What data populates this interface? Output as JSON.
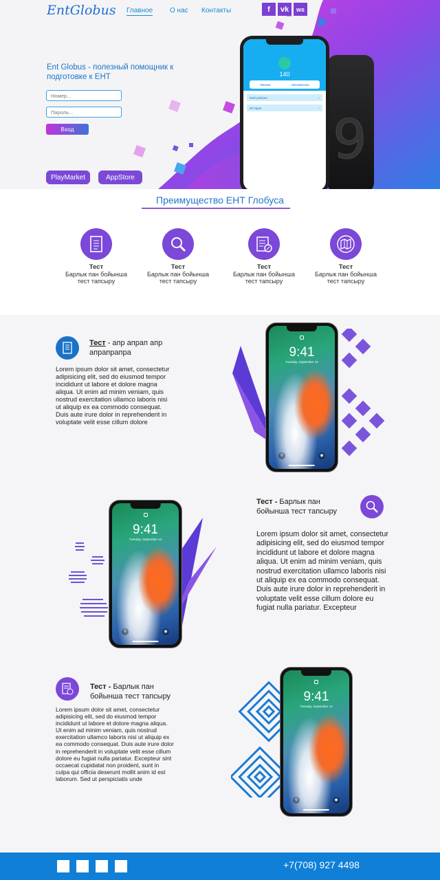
{
  "header": {
    "logo": "EntGlobus",
    "nav": [
      {
        "label": "Главное",
        "active": true
      },
      {
        "label": "О нас",
        "active": false
      },
      {
        "label": "Контакты",
        "active": false
      }
    ],
    "social": [
      "f",
      "vk",
      "ws"
    ]
  },
  "hero": {
    "title": "Ent Globus - полезный помощник к подготовке к ЕНТ",
    "number_placeholder": "Номер...",
    "password_placeholder": "Пароль...",
    "login_label": "Вход",
    "playmarket_label": "PlayMarket",
    "appstore_label": "AppStore",
    "app_screen": {
      "score": "140",
      "tab_left": "Физика",
      "tab_right": "Математика",
      "rows": [
        "Мой рейтинг",
        "История"
      ]
    }
  },
  "advantages": {
    "title": "Преимущество   ЕНТ Глобуса",
    "items": [
      {
        "icon": "document-list-icon",
        "title": "Тест",
        "text": "Барлык пан бойынша тест тапсыру"
      },
      {
        "icon": "magnifier-icon",
        "title": "Тест",
        "text": "Барлык пан бойынша тест тапсыру"
      },
      {
        "icon": "checklist-icon",
        "title": "Тест",
        "text": "Барлык пан бойынша тест тапсыру"
      },
      {
        "icon": "map-icon",
        "title": "Тест",
        "text": "Барлык пан бойынша тест тапсыру"
      }
    ]
  },
  "features": [
    {
      "title_bold": "Тест",
      "title_rest": " - апр апрап апр апрапрапра",
      "text": "Lorem ipsum dolor sit amet, consectetur adipisicing elit, sed do eiusmod tempor incididunt ut labore et dolore magna aliqua. Ut enim ad minim veniam, quis nostrud exercitation ullamco laboris nisi ut aliquip ex ea commodo consequat. Duis aute irure dolor in reprehenderit in voluptate velit esse cillum dolore"
    },
    {
      "title_bold": "Тест -",
      "title_rest": " Барлык пан бойынша тест тапсыру",
      "text": "Lorem ipsum dolor sit amet, consectetur adipisicing elit, sed do eiusmod tempor incididunt ut labore et dolore magna aliqua. Ut enim ad minim veniam, quis nostrud exercitation ullamco laboris nisi ut aliquip ex ea commodo consequat. Duis aute irure dolor in reprehenderit in voluptate velit esse cillum dolore eu fugiat nulla pariatur. Excepteur"
    },
    {
      "title_bold": "Тест -",
      "title_rest": " Барлык пан бойынша тест тапсыру",
      "text": "Lorem ipsum dolor sit amet, consectetur adipisicing elit, sed do eiusmod tempor incididunt ut labore et dolore magna aliqua. Ut enim ad minim veniam, quis nostrud exercitation ullamco laboris nisi ut aliquip ex ea commodo consequat. Duis aute irure dolor in reprehenderit in voluptate velit esse cillum dolore eu fugiat nulla pariatur. Excepteur sint occaecat cupidatat non proident, sunt in culpa qui officia deserunt mollit anim id est laborum. Sed ut perspiciatis unde"
    }
  ],
  "phone_screen": {
    "time": "9:41",
    "date": "Tuesday, September 12"
  },
  "footer": {
    "phone": "+7(708) 927 4498"
  },
  "colors": {
    "accent_purple": "#7b48d8",
    "accent_blue": "#1f6ed0",
    "footer_blue": "#0f7fd8"
  }
}
